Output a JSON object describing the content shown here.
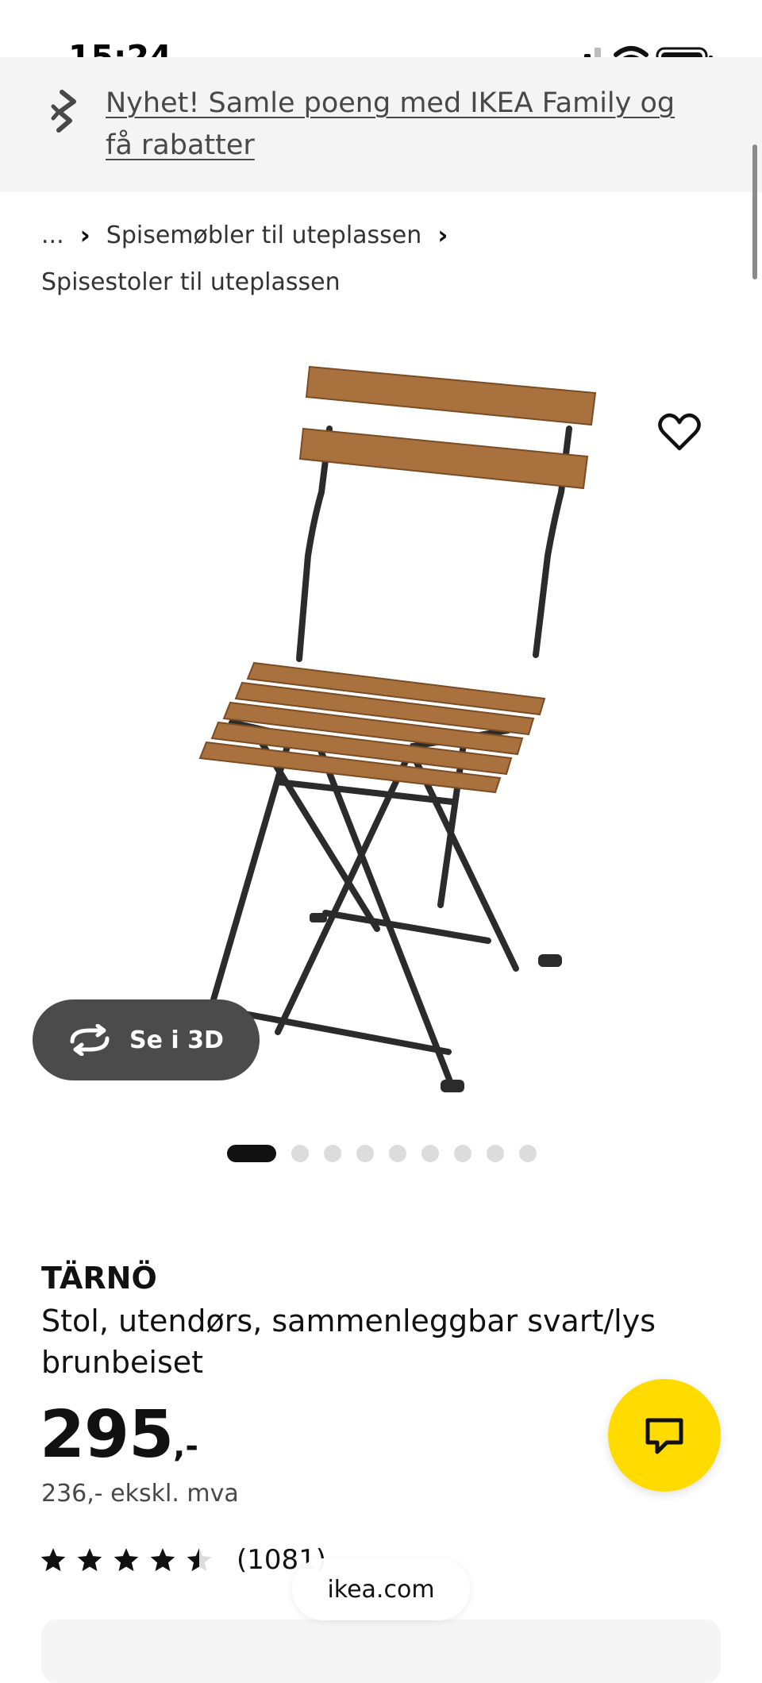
{
  "status_bar": {
    "time": "15:24"
  },
  "banner": {
    "text": "Nyhet! Samle poeng med IKEA Family og få rabatter",
    "icon": "ikea-family-icon"
  },
  "breadcrumb": {
    "ellipsis": "...",
    "level1": "Spisemøbler til uteplassen",
    "current": "Spisestoler til uteplassen"
  },
  "gallery": {
    "view_3d_label": "Se i 3D",
    "image_count": 9,
    "active_index": 0
  },
  "product": {
    "name": "TÄRNÖ",
    "description": "Stol, utendørs, sammenleggbar svart/lys brunbeiset",
    "price_integer": "295",
    "price_suffix": ",-",
    "price_ex_vat": "236,- ekskl. mva",
    "rating": 4.5,
    "review_count": "(1081)"
  },
  "browser": {
    "url": "ikea.com"
  },
  "colors": {
    "chat_button": "#ffdb00",
    "view_3d_button": "#4b4b4b",
    "chair_wood": "#a8713d",
    "chair_frame": "#2b2b2b"
  }
}
